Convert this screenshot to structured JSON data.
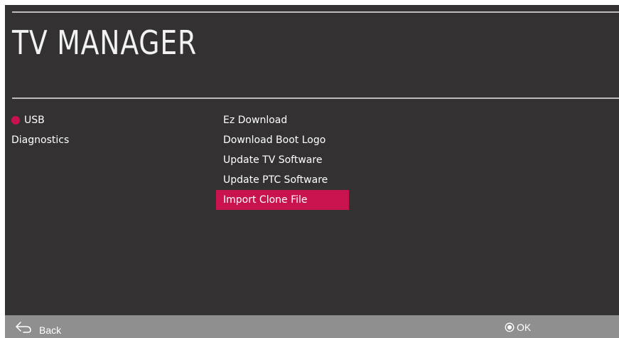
{
  "header": {
    "title": "TV MANAGER"
  },
  "left_menu": {
    "items": [
      {
        "label": "USB"
      },
      {
        "label": "Diagnostics"
      }
    ]
  },
  "right_menu": {
    "items": [
      {
        "label": "Ez Download"
      },
      {
        "label": "Download Boot Logo"
      },
      {
        "label": "Update TV Software"
      },
      {
        "label": "Update PTC Software"
      },
      {
        "label": "Import Clone File"
      }
    ],
    "selected_label": "Import Clone File"
  },
  "footer": {
    "back_label": "Back",
    "ok_label": "OK"
  },
  "colors": {
    "background": "#333132",
    "accent": "#c8134f",
    "footer": "#8f8f8f",
    "rule": "#bdbdbd"
  },
  "icons": {
    "back": "back-arrow-icon",
    "ok": "ok-circle-icon",
    "active_marker": "active-dot-icon"
  }
}
